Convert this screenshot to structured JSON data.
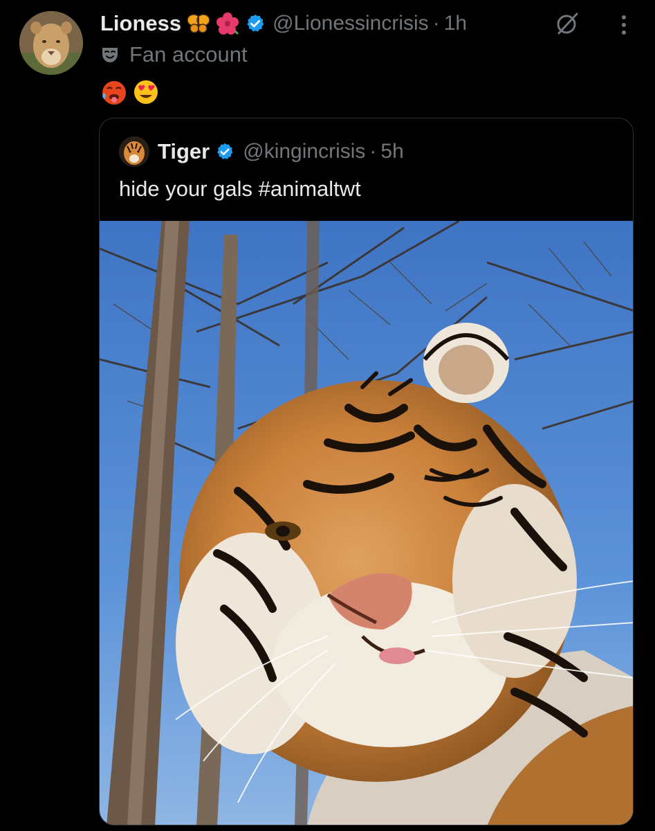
{
  "post": {
    "author": {
      "display_name": "Lioness",
      "name_emojis": [
        "butterfly-emoji",
        "hibiscus-emoji"
      ],
      "verified": true,
      "handle": "@Lionessincrisis",
      "separator": "·",
      "time": "1h",
      "avatar": "lioness-avatar"
    },
    "affiliation": {
      "icon": "mask-icon",
      "label": "Fan account"
    },
    "text_emojis": [
      "hot-face-emoji",
      "heart-eyes-emoji"
    ],
    "actions": {
      "grok": "grok-icon",
      "more": "more-icon"
    }
  },
  "quoted_post": {
    "author": {
      "display_name": "Tiger",
      "verified": true,
      "handle": "@kingincrisis",
      "separator": "·",
      "time": "5h",
      "avatar": "tiger-avatar"
    },
    "text": "hide your gals #animaltwt",
    "media": "tiger-photo"
  },
  "colors": {
    "background": "#000000",
    "primary_text": "#e7e9ea",
    "secondary_text": "#71767b",
    "verified_blue": "#1d9bf0",
    "border": "#2f3336"
  }
}
